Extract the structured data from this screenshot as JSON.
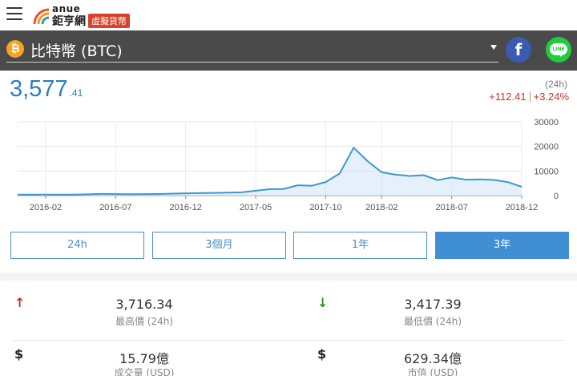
{
  "brand": {
    "name": "anue",
    "cn_name": "鉅亨網",
    "section_tag": "虛擬貨幣"
  },
  "coin": {
    "icon_glyph": "₿",
    "label": "比特幣 (BTC)"
  },
  "share": {
    "facebook_glyph": "f",
    "line_text": "LINE"
  },
  "price": {
    "integer": "3,577",
    "decimal": ".41",
    "period": "(24h)",
    "change_abs": "+112.41",
    "change_pct": "+3.24%"
  },
  "colors": {
    "accent": "#3f8fd2",
    "up": "#c0362c",
    "down": "#2e8b2e",
    "header_bg": "#4a4a4a"
  },
  "chart_data": {
    "type": "area",
    "x_tick_labels": [
      "2016-02",
      "2016-07",
      "2016-12",
      "2017-05",
      "2017-10",
      "2018-02",
      "2018-07",
      "2018-12"
    ],
    "y_tick_labels": [
      "30000",
      "20000",
      "10000",
      "0"
    ],
    "ylim": [
      0,
      30000
    ],
    "grid": true,
    "series": [
      {
        "points": [
          [
            "2015-12",
            430
          ],
          [
            "2016-02",
            410
          ],
          [
            "2016-04",
            430
          ],
          [
            "2016-06",
            680
          ],
          [
            "2016-08",
            580
          ],
          [
            "2016-10",
            640
          ],
          [
            "2016-12",
            960
          ],
          [
            "2017-02",
            1100
          ],
          [
            "2017-04",
            1350
          ],
          [
            "2017-05",
            2000
          ],
          [
            "2017-06",
            2600
          ],
          [
            "2017-07",
            2700
          ],
          [
            "2017-08",
            4200
          ],
          [
            "2017-09",
            4000
          ],
          [
            "2017-10",
            5500
          ],
          [
            "2017-11",
            9000
          ],
          [
            "2017-12",
            19500
          ],
          [
            "2018-01",
            14000
          ],
          [
            "2018-02",
            9500
          ],
          [
            "2018-03",
            8500
          ],
          [
            "2018-04",
            8000
          ],
          [
            "2018-05",
            8300
          ],
          [
            "2018-06",
            6300
          ],
          [
            "2018-07",
            7400
          ],
          [
            "2018-08",
            6500
          ],
          [
            "2018-09",
            6600
          ],
          [
            "2018-10",
            6400
          ],
          [
            "2018-11",
            5500
          ],
          [
            "2018-12",
            3600
          ]
        ]
      }
    ]
  },
  "tabs": [
    {
      "label": "24h",
      "active": false
    },
    {
      "label": "3個月",
      "active": false
    },
    {
      "label": "1年",
      "active": false
    },
    {
      "label": "3年",
      "active": true
    }
  ],
  "stats": {
    "high": {
      "symbol": "↑",
      "value": "3,716.34",
      "label": "最高價 (24h)"
    },
    "low": {
      "symbol": "↓",
      "value": "3,417.39",
      "label": "最低價 (24h)"
    },
    "volume": {
      "symbol": "$",
      "value": "15.79億",
      "label": "成交量 (USD)"
    },
    "market_cap": {
      "symbol": "$",
      "value": "629.34億",
      "label": "市值 (USD)"
    }
  }
}
